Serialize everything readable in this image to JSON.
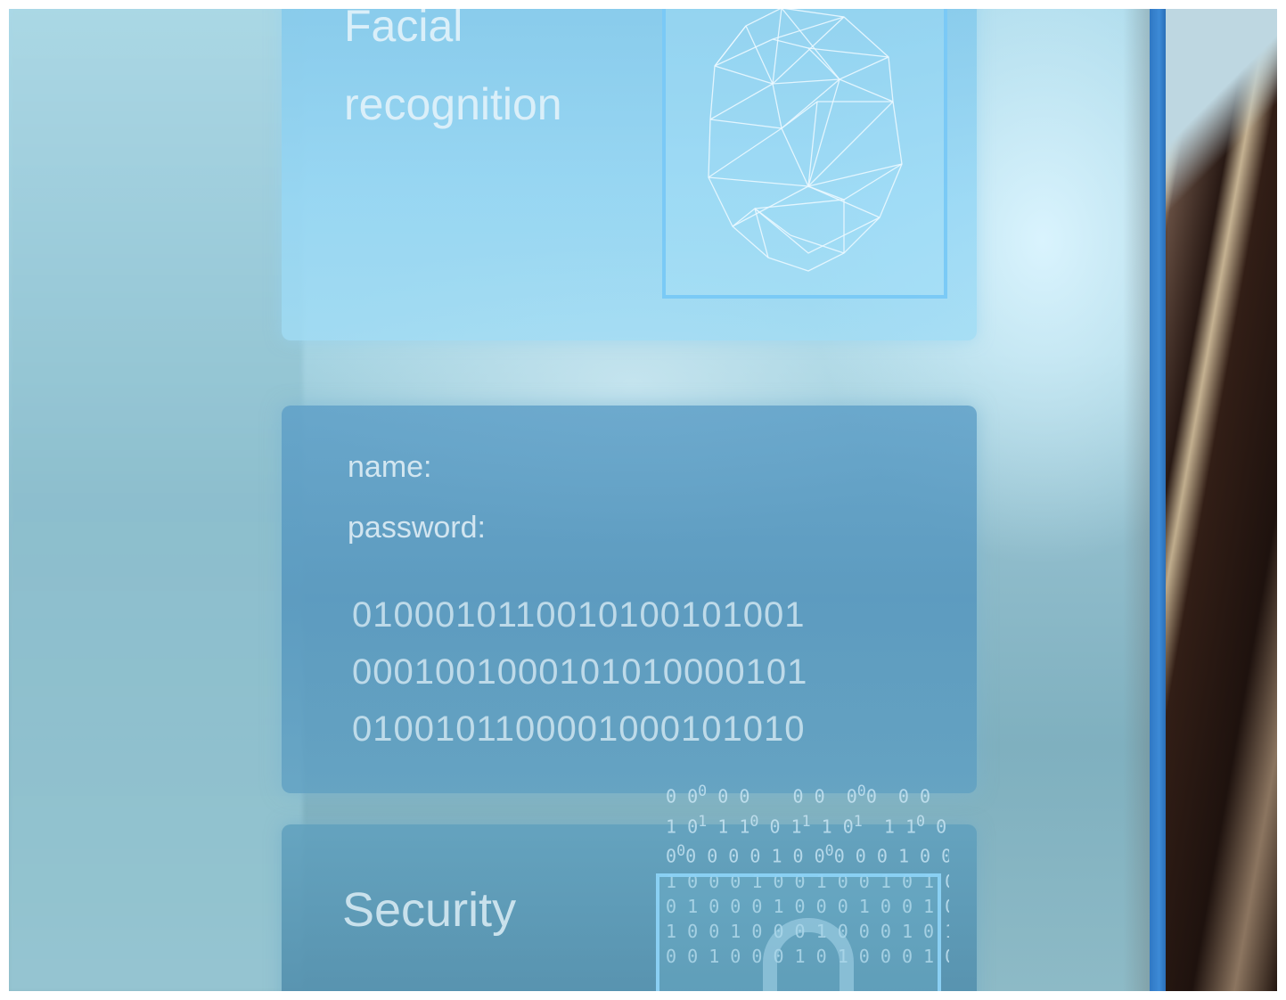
{
  "face_panel": {
    "title_line1": "Facial",
    "title_line2": "recognition"
  },
  "login_panel": {
    "name_label": "name:",
    "password_label": "password:",
    "binary_lines": [
      "0100010110010100101001",
      "0001001000101010000101",
      "0100101100001000101010"
    ]
  },
  "security_panel": {
    "title": "Security"
  },
  "colors": {
    "accent_bar": "#2f78c4",
    "panel_light": "#96d7f5",
    "panel_dark": "#5fa0c8",
    "text": "#e3f3fb"
  },
  "icons": [
    "face-mesh-icon",
    "padlock-icon"
  ]
}
